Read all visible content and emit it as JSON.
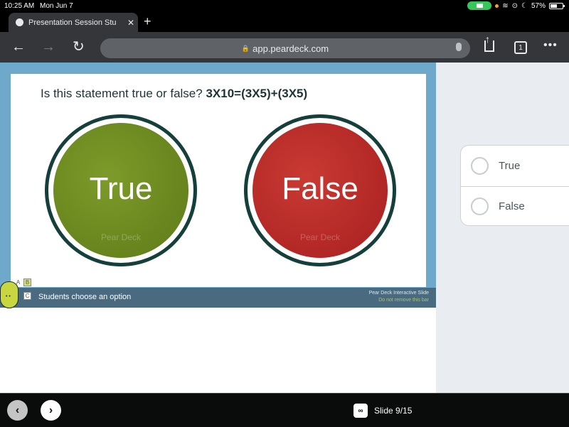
{
  "status_bar": {
    "time": "10:25 AM",
    "date": "Mon Jun 7",
    "battery_percent": "57%",
    "battery_level": 0.57
  },
  "browser": {
    "tab_title": "Presentation Session Stu",
    "tab_close": "✕",
    "new_tab": "+",
    "back": "←",
    "forward": "→",
    "reload": "↻",
    "url": "app.peardeck.com",
    "lock": "🔒",
    "tab_count": "1",
    "more": "•••"
  },
  "slide": {
    "question_prefix": "Is this statement true or false? ",
    "question_equation": "3X10=(3X5)+(3X5)",
    "options": [
      {
        "label": "True",
        "color": "#6b8a20"
      },
      {
        "label": "False",
        "color": "#b82b28"
      }
    ],
    "watermark": "Pear Deck",
    "bar_text": "Students choose an option",
    "bar_right_line1": "Pear Deck Interactive Slide",
    "bar_right_line2": "Do not remove this bar",
    "abc": [
      "A",
      "B",
      "C"
    ]
  },
  "response_panel": {
    "choices": [
      {
        "label": "True"
      },
      {
        "label": "False"
      }
    ]
  },
  "bottom_bar": {
    "prev": "‹",
    "next": "›",
    "pd_icon": "∞",
    "slide_indicator": "Slide 9/15"
  }
}
